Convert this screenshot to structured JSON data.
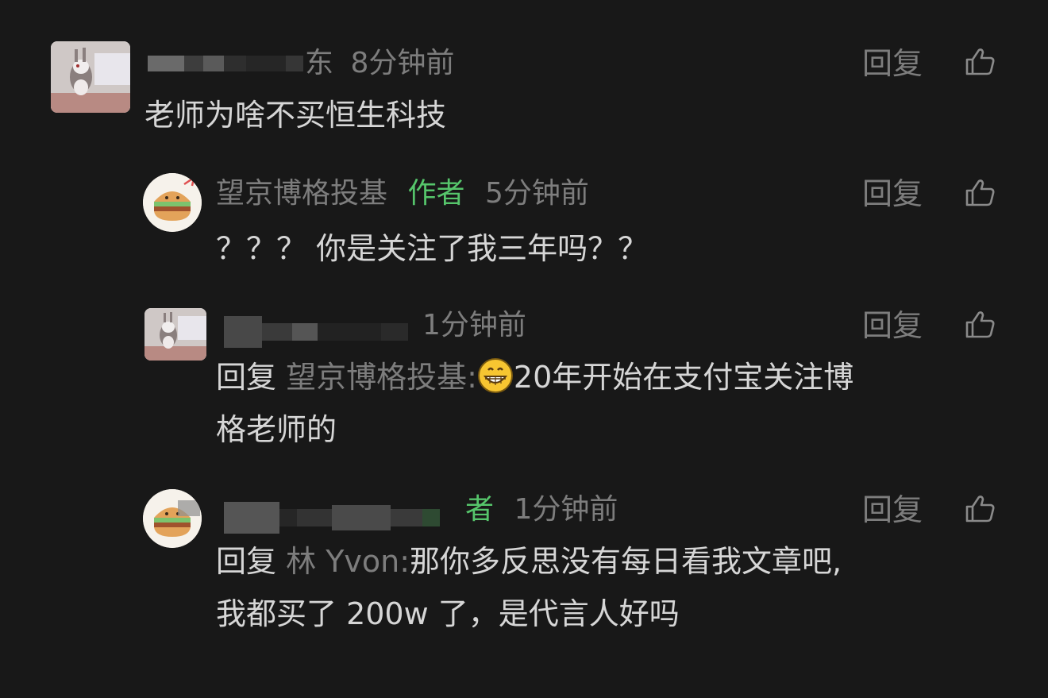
{
  "comments": [
    {
      "name_suffix": "东",
      "time": "8分钟前",
      "text": "老师为啥不买恒生科技",
      "reply_label": "回复"
    },
    {
      "name": "望京博格投基",
      "author_tag": "作者",
      "time": "5分钟前",
      "text": "？？？ 你是关注了我三年吗？？",
      "reply_label": "回复"
    },
    {
      "time": "1分钟前",
      "reply_prefix": "回复",
      "reply_to": "望京博格投基:",
      "text_line1": "20年开始在支付宝关注博",
      "text_line2": "格老师的",
      "reply_label": "回复"
    },
    {
      "author_tag": "者",
      "time": "1分钟前",
      "reply_prefix": "回复",
      "reply_to": "林 Yvon:",
      "text_line1": "那你多反思没有每日看我文章吧,",
      "text_line2": "我都买了 200w 了，是代言人好吗",
      "reply_label": "回复"
    }
  ],
  "icons": {
    "like": "thumbs-up-icon",
    "emoji": "grin-emoji-icon"
  },
  "colors": {
    "background": "#181818",
    "text": "#d6d6d6",
    "meta": "#7d7d7d",
    "author": "#56c56b"
  }
}
